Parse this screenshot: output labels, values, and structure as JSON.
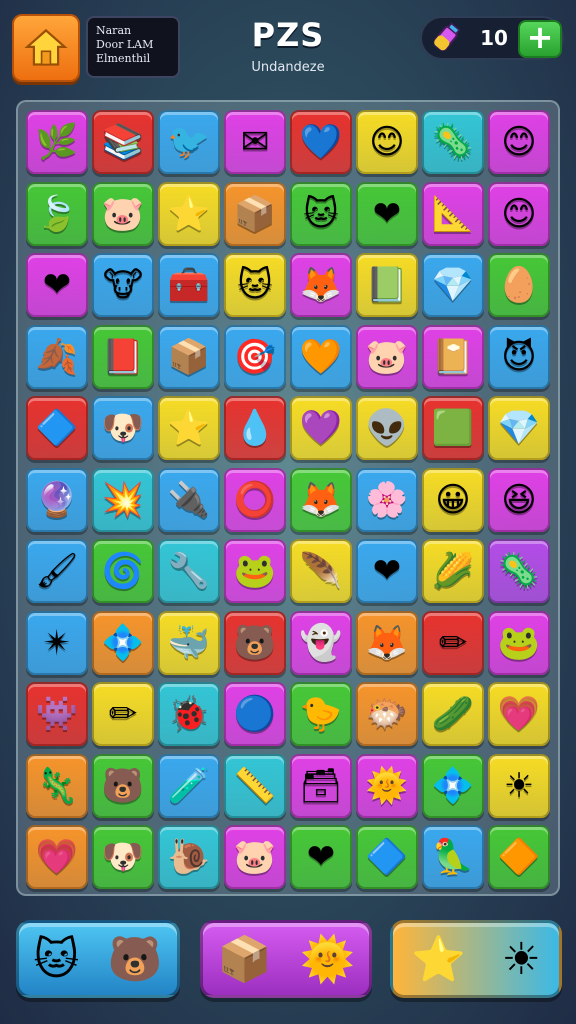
{
  "header": {
    "info_lines": [
      "Naran",
      "Door LAM",
      "Elmenthil"
    ],
    "title": "PZS",
    "subtitle": "Undandeze",
    "currency_count": "10",
    "plus_label": "+"
  },
  "icons": {
    "home": "home-icon",
    "potion": "potion-icon"
  },
  "colors": {
    "green": "#46c836",
    "pink": "#e040e6",
    "blue": "#3aa8ee",
    "yellow": "#f7dc24",
    "orange": "#f7942a",
    "red": "#e8322e",
    "cyan": "#33c6d6",
    "violet": "#b44ce8",
    "lime": "#8ad636"
  },
  "grid": [
    [
      {
        "c": "pink",
        "i": "🌿"
      },
      {
        "c": "red",
        "i": "📚"
      },
      {
        "c": "blue",
        "i": "🐦"
      },
      {
        "c": "pink",
        "i": "✉"
      },
      {
        "c": "red",
        "i": "💙"
      },
      {
        "c": "yellow",
        "i": "😊"
      },
      {
        "c": "cyan",
        "i": "🦠"
      },
      {
        "c": "pink",
        "i": "😊"
      }
    ],
    [
      {
        "c": "green",
        "i": "🍃"
      },
      {
        "c": "green",
        "i": "🐷"
      },
      {
        "c": "yellow",
        "i": "⭐"
      },
      {
        "c": "orange",
        "i": "📦"
      },
      {
        "c": "green",
        "i": "🐱"
      },
      {
        "c": "green",
        "i": "❤"
      },
      {
        "c": "pink",
        "i": "📐"
      },
      {
        "c": "pink",
        "i": "😊"
      }
    ],
    [
      {
        "c": "pink",
        "i": "❤"
      },
      {
        "c": "blue",
        "i": "🐮"
      },
      {
        "c": "blue",
        "i": "🧰"
      },
      {
        "c": "yellow",
        "i": "🐱"
      },
      {
        "c": "pink",
        "i": "🦊"
      },
      {
        "c": "yellow",
        "i": "📗"
      },
      {
        "c": "blue",
        "i": "💎"
      },
      {
        "c": "green",
        "i": "🥚"
      }
    ],
    [
      {
        "c": "blue",
        "i": "🍂"
      },
      {
        "c": "green",
        "i": "📕"
      },
      {
        "c": "blue",
        "i": "📦"
      },
      {
        "c": "blue",
        "i": "🎯"
      },
      {
        "c": "blue",
        "i": "🧡"
      },
      {
        "c": "pink",
        "i": "🐷"
      },
      {
        "c": "pink",
        "i": "📔"
      },
      {
        "c": "blue",
        "i": "😈"
      }
    ],
    [
      {
        "c": "red",
        "i": "🔷"
      },
      {
        "c": "blue",
        "i": "🐶"
      },
      {
        "c": "yellow",
        "i": "⭐"
      },
      {
        "c": "red",
        "i": "💧"
      },
      {
        "c": "yellow",
        "i": "💜"
      },
      {
        "c": "yellow",
        "i": "👽"
      },
      {
        "c": "red",
        "i": "🟩"
      },
      {
        "c": "yellow",
        "i": "💎"
      }
    ],
    [
      {
        "c": "blue",
        "i": "🔮"
      },
      {
        "c": "cyan",
        "i": "💥"
      },
      {
        "c": "blue",
        "i": "🔌"
      },
      {
        "c": "pink",
        "i": "⭕"
      },
      {
        "c": "green",
        "i": "🦊"
      },
      {
        "c": "blue",
        "i": "🌸"
      },
      {
        "c": "yellow",
        "i": "😀"
      },
      {
        "c": "pink",
        "i": "😆"
      }
    ],
    [
      {
        "c": "blue",
        "i": "🖌"
      },
      {
        "c": "green",
        "i": "🌀"
      },
      {
        "c": "cyan",
        "i": "🔧"
      },
      {
        "c": "pink",
        "i": "🐸"
      },
      {
        "c": "yellow",
        "i": "🪶"
      },
      {
        "c": "blue",
        "i": "❤"
      },
      {
        "c": "yellow",
        "i": "🌽"
      },
      {
        "c": "violet",
        "i": "🦠"
      }
    ],
    [
      {
        "c": "blue",
        "i": "✴"
      },
      {
        "c": "orange",
        "i": "💠"
      },
      {
        "c": "yellow",
        "i": "🐳"
      },
      {
        "c": "red",
        "i": "🐻"
      },
      {
        "c": "pink",
        "i": "👻"
      },
      {
        "c": "orange",
        "i": "🦊"
      },
      {
        "c": "red",
        "i": "✏"
      },
      {
        "c": "pink",
        "i": "🐸"
      }
    ],
    [
      {
        "c": "red",
        "i": "👾"
      },
      {
        "c": "yellow",
        "i": "✏"
      },
      {
        "c": "cyan",
        "i": "🐞"
      },
      {
        "c": "pink",
        "i": "🔵"
      },
      {
        "c": "green",
        "i": "🐤"
      },
      {
        "c": "orange",
        "i": "🐡"
      },
      {
        "c": "yellow",
        "i": "🥒"
      },
      {
        "c": "yellow",
        "i": "💗"
      }
    ],
    [
      {
        "c": "orange",
        "i": "🦎"
      },
      {
        "c": "green",
        "i": "🐻"
      },
      {
        "c": "blue",
        "i": "🧪"
      },
      {
        "c": "cyan",
        "i": "📏"
      },
      {
        "c": "pink",
        "i": "🗃"
      },
      {
        "c": "pink",
        "i": "🌞"
      },
      {
        "c": "green",
        "i": "💠"
      },
      {
        "c": "yellow",
        "i": "☀"
      }
    ],
    [
      {
        "c": "orange",
        "i": "💗"
      },
      {
        "c": "green",
        "i": "🐶"
      },
      {
        "c": "cyan",
        "i": "🐌"
      },
      {
        "c": "pink",
        "i": "🐷"
      },
      {
        "c": "green",
        "i": "❤"
      },
      {
        "c": "green",
        "i": "🔷"
      },
      {
        "c": "blue",
        "i": "🦜"
      },
      {
        "c": "green",
        "i": "🔶"
      }
    ]
  ],
  "bottom_buttons": [
    {
      "icons": [
        "🐱",
        "🐻"
      ]
    },
    {
      "icons": [
        "📦",
        "🌞"
      ]
    },
    {
      "icons": [
        "⭐",
        "☀"
      ]
    }
  ]
}
